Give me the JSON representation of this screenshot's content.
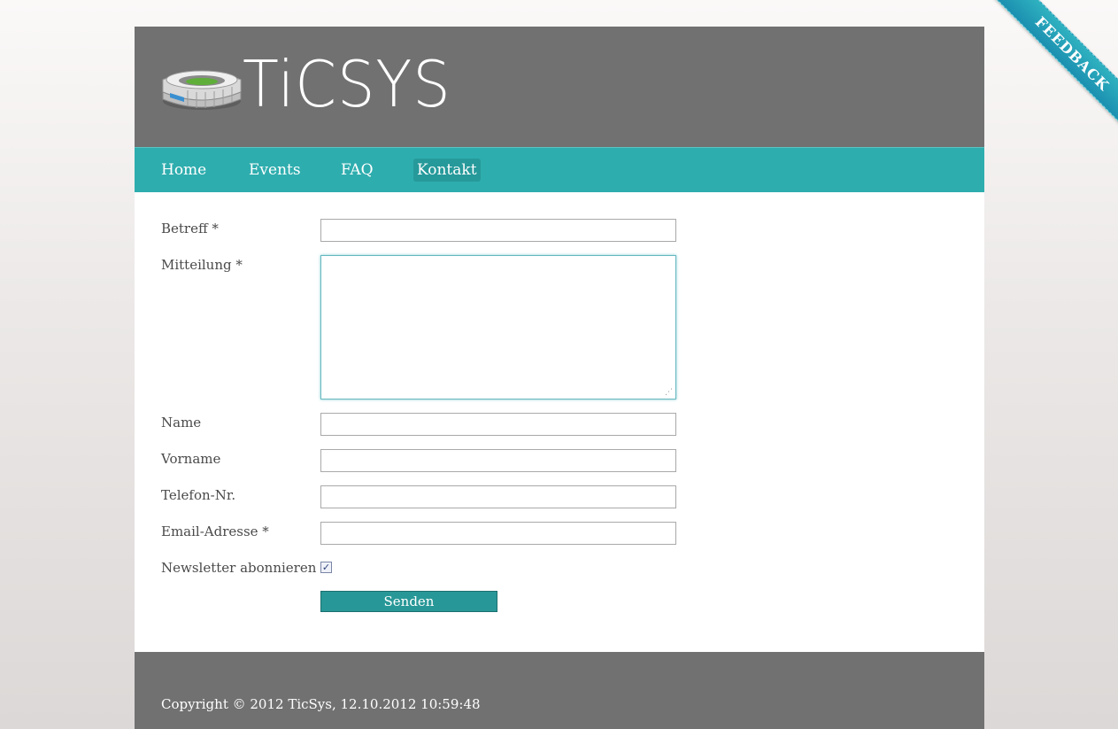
{
  "header": {
    "logo_text": "TiCSYS",
    "logo_icon": "stadium-icon"
  },
  "nav": {
    "items": [
      {
        "label": "Home",
        "active": false
      },
      {
        "label": "Events",
        "active": false
      },
      {
        "label": "FAQ",
        "active": false
      },
      {
        "label": "Kontakt",
        "active": true
      }
    ]
  },
  "form": {
    "subject_label": "Betreff *",
    "subject_value": "",
    "message_label": "Mitteilung *",
    "message_value": "",
    "name_label": "Name",
    "name_value": "",
    "firstname_label": "Vorname",
    "firstname_value": "",
    "phone_label": "Telefon-Nr.",
    "phone_value": "",
    "email_label": "Email-Adresse *",
    "email_value": "",
    "newsletter_label": "Newsletter abonnieren",
    "newsletter_checked": true,
    "submit_label": "Senden"
  },
  "footer": {
    "copyright": "Copyright © 2012 TicSys, 12.10.2012 10:59:48"
  },
  "feedback": {
    "label": "FEEDBACK"
  },
  "colors": {
    "header_bg": "#717171",
    "nav_bg": "#2eadae",
    "nav_active_bg": "#26999a",
    "button_bg": "#289797",
    "ribbon": "#1b8fb0"
  }
}
